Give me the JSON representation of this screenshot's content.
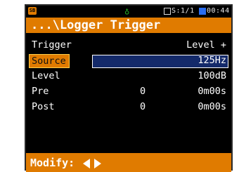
{
  "status_bar": {
    "badge": "SB",
    "sound_icon": "sound-icon",
    "page_indicator": "S:1/1",
    "time": "00:44"
  },
  "title": "...\\Logger Trigger",
  "rows": [
    {
      "label": "Trigger",
      "value": "Level +",
      "mid": ""
    },
    {
      "label": "Source",
      "value": "125Hz",
      "mid": ""
    },
    {
      "label": "Level",
      "value": "100dB",
      "mid": ""
    },
    {
      "label": "Pre",
      "value": "0m00s",
      "mid": "0"
    },
    {
      "label": "Post",
      "value": "0m00s",
      "mid": "0"
    }
  ],
  "bottom": {
    "modify_label": "Modify:"
  },
  "colors": {
    "accent": "#e07b00",
    "selection": "#142a6a",
    "background": "#000000",
    "text": "#ffffff"
  }
}
